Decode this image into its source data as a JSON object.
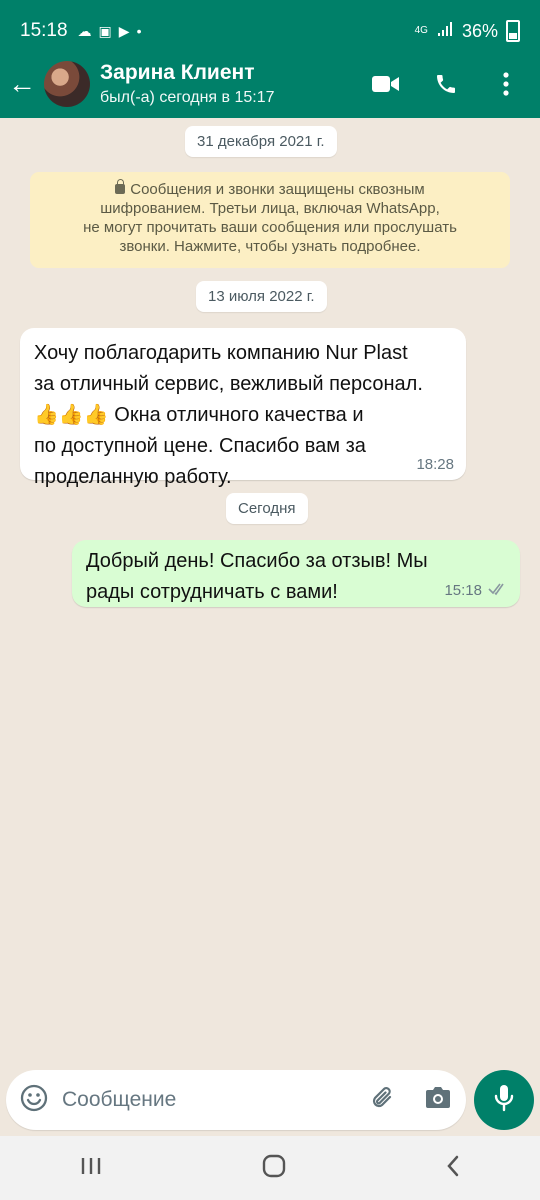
{
  "status_bar": {
    "time": "15:18",
    "network": "4G",
    "battery": "36%"
  },
  "header": {
    "contact_name": "Зарина Клиент",
    "last_seen": "был(-а) сегодня в 15:17"
  },
  "chat": {
    "date_1": "31 декабря 2021 г.",
    "security_notice": [
      "Сообщения и звонки защищены сквозным",
      "шифрованием. Третьи лица, включая WhatsApp,",
      "не могут прочитать ваши сообщения или прослушать",
      "звонки. Нажмите, чтобы узнать подробнее."
    ],
    "date_2": "13 июля 2022 г.",
    "incoming_message": {
      "lines": [
        "Хочу поблагодарить компанию Nur Plast",
        "за отличный сервис, вежливый персонал.",
        "👍👍👍 Окна отличного качества и",
        "по доступной цене. Спасибо вам за",
        "проделанную работу."
      ],
      "time": "18:28"
    },
    "date_3": "Сегодня",
    "outgoing_message": {
      "lines": [
        "Добрый день! Спасибо за отзыв! Мы",
        "рады сотрудничать с вами!"
      ],
      "time": "15:18"
    }
  },
  "composer": {
    "placeholder": "Сообщение"
  },
  "colors": {
    "header": "#008069",
    "incoming_bubble": "#ffffff",
    "outgoing_bubble": "#d9fdd3",
    "security_notice": "#fcefc4",
    "chat_background": "#efe7dd"
  }
}
